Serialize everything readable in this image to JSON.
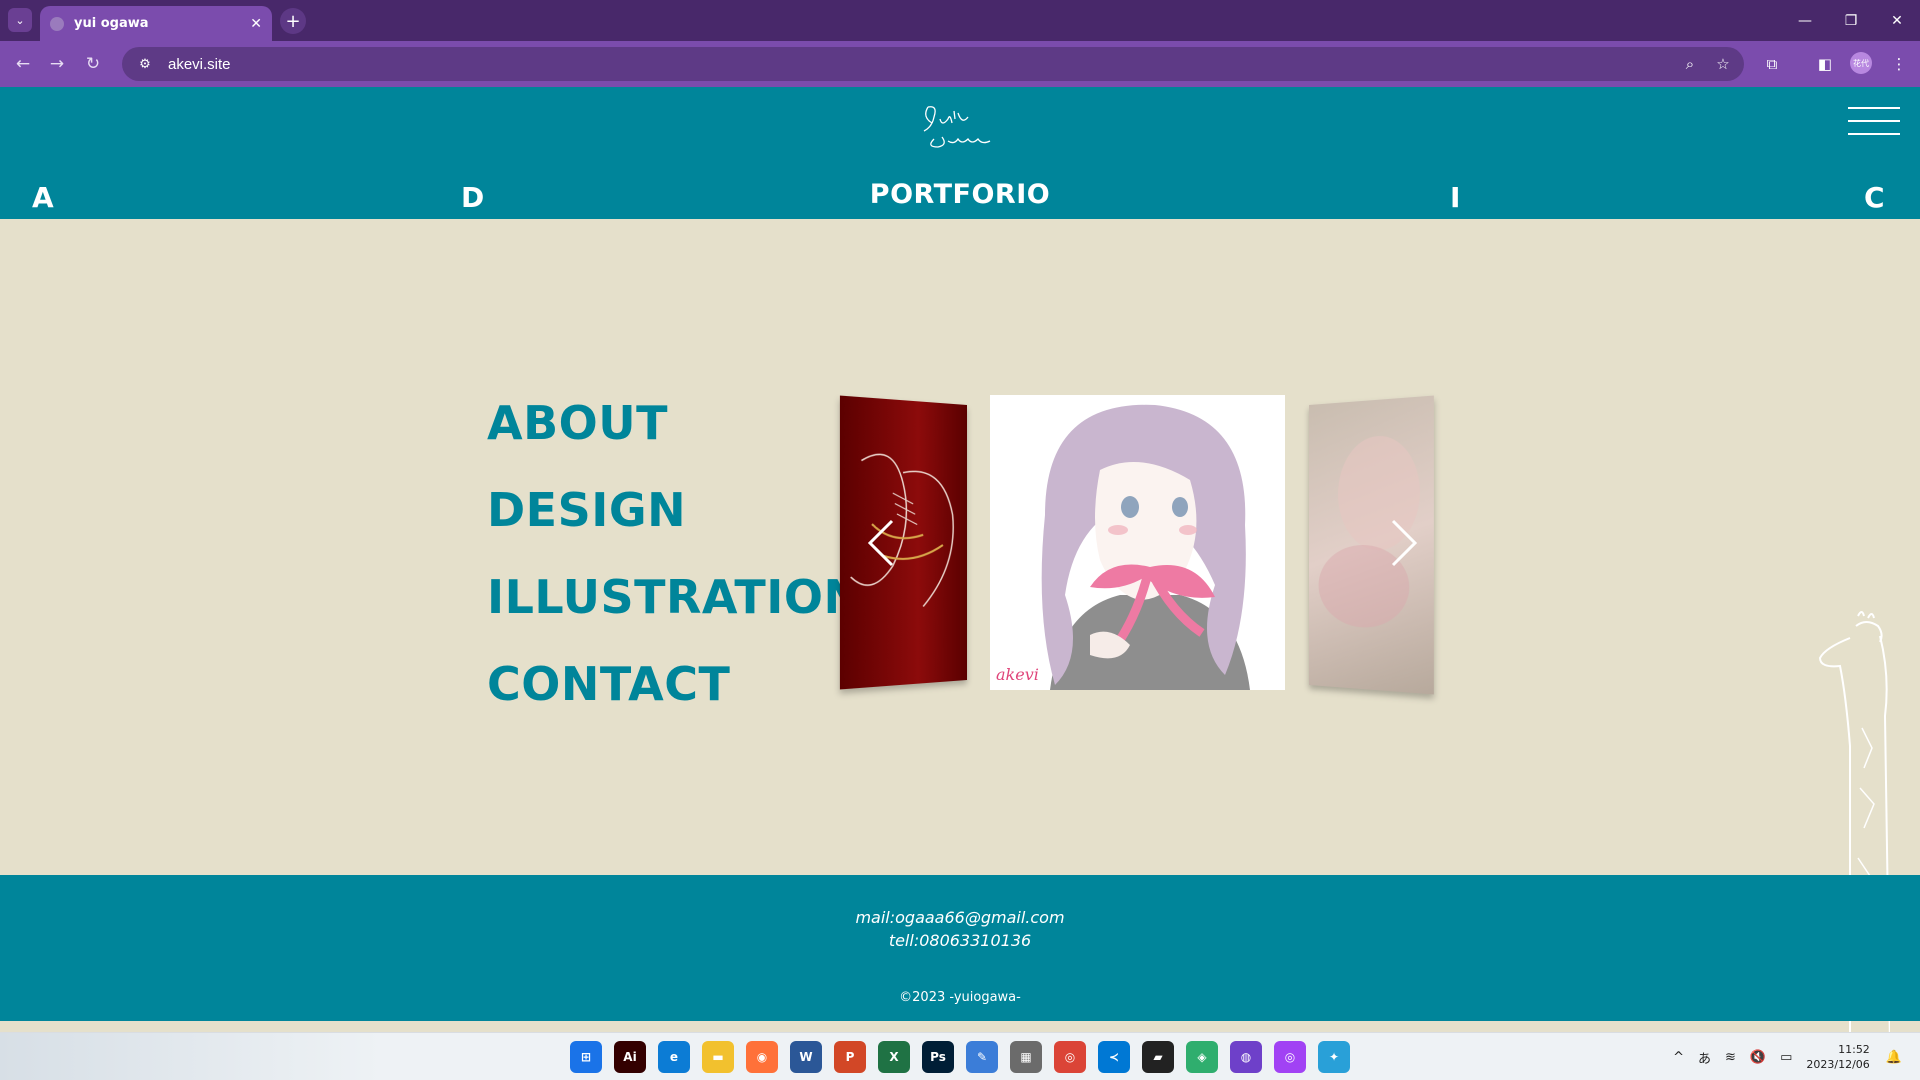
{
  "browser": {
    "tab_title": "yui ogawa",
    "tab_close": "✕",
    "new_tab": "+",
    "url": "akevi.site",
    "profile_label": "花代",
    "window": {
      "minimize": "—",
      "restore": "❐",
      "close": "✕"
    },
    "icons": {
      "back": "←",
      "forward": "→",
      "reload": "↻",
      "site_info": "⚙",
      "zoom": "⌕",
      "bookmark": "☆",
      "extensions": "⧉",
      "side_panel": "◧",
      "menu": "⋮",
      "tab_search": "⌄"
    }
  },
  "site": {
    "header_letters": [
      "A",
      "D",
      "I",
      "C"
    ],
    "title": "PORTFORIO",
    "logo_text": "Yui Ogawa",
    "menu": [
      "ABOUT",
      "DESIGN",
      "ILLUSTRATION",
      "CONTACT"
    ],
    "carousel": {
      "signature": "akevi"
    },
    "footer": {
      "mail": "mail:ogaaa66@gmail.com",
      "tell": "tell:08063310136",
      "copyright": "©2023 -yuiogawa-"
    }
  },
  "taskbar": {
    "apps": [
      {
        "name": "start",
        "label": "⊞",
        "color": "#1a73e8"
      },
      {
        "name": "illustrator",
        "label": "Ai",
        "color": "#330000"
      },
      {
        "name": "edge",
        "label": "e",
        "color": "#0c7cd5"
      },
      {
        "name": "explorer",
        "label": "▬",
        "color": "#f2c12e"
      },
      {
        "name": "firefox",
        "label": "◉",
        "color": "#ff7139"
      },
      {
        "name": "word",
        "label": "W",
        "color": "#2b5797"
      },
      {
        "name": "powerpoint",
        "label": "P",
        "color": "#d24726"
      },
      {
        "name": "excel",
        "label": "X",
        "color": "#1f7244"
      },
      {
        "name": "photoshop",
        "label": "Ps",
        "color": "#001e36"
      },
      {
        "name": "paint",
        "label": "✎",
        "color": "#3b7dd8"
      },
      {
        "name": "calculator",
        "label": "▦",
        "color": "#6b6b6b"
      },
      {
        "name": "chrome",
        "label": "◎",
        "color": "#db4437"
      },
      {
        "name": "vscode",
        "label": "≺",
        "color": "#0078d4"
      },
      {
        "name": "sticky",
        "label": "▰",
        "color": "#222"
      },
      {
        "name": "app-green",
        "label": "◈",
        "color": "#2fae6e"
      },
      {
        "name": "github",
        "label": "◍",
        "color": "#6e40c9"
      },
      {
        "name": "chrome-profile",
        "label": "◎",
        "color": "#a142f4"
      },
      {
        "name": "app-blue",
        "label": "✦",
        "color": "#29a0d8"
      }
    ],
    "tray": {
      "chevron": "^",
      "ime": "あ",
      "wifi": "≋",
      "volume": "🔇",
      "battery": "▭",
      "notification": "🔔"
    },
    "time": "11:52",
    "date": "2023/12/06"
  }
}
